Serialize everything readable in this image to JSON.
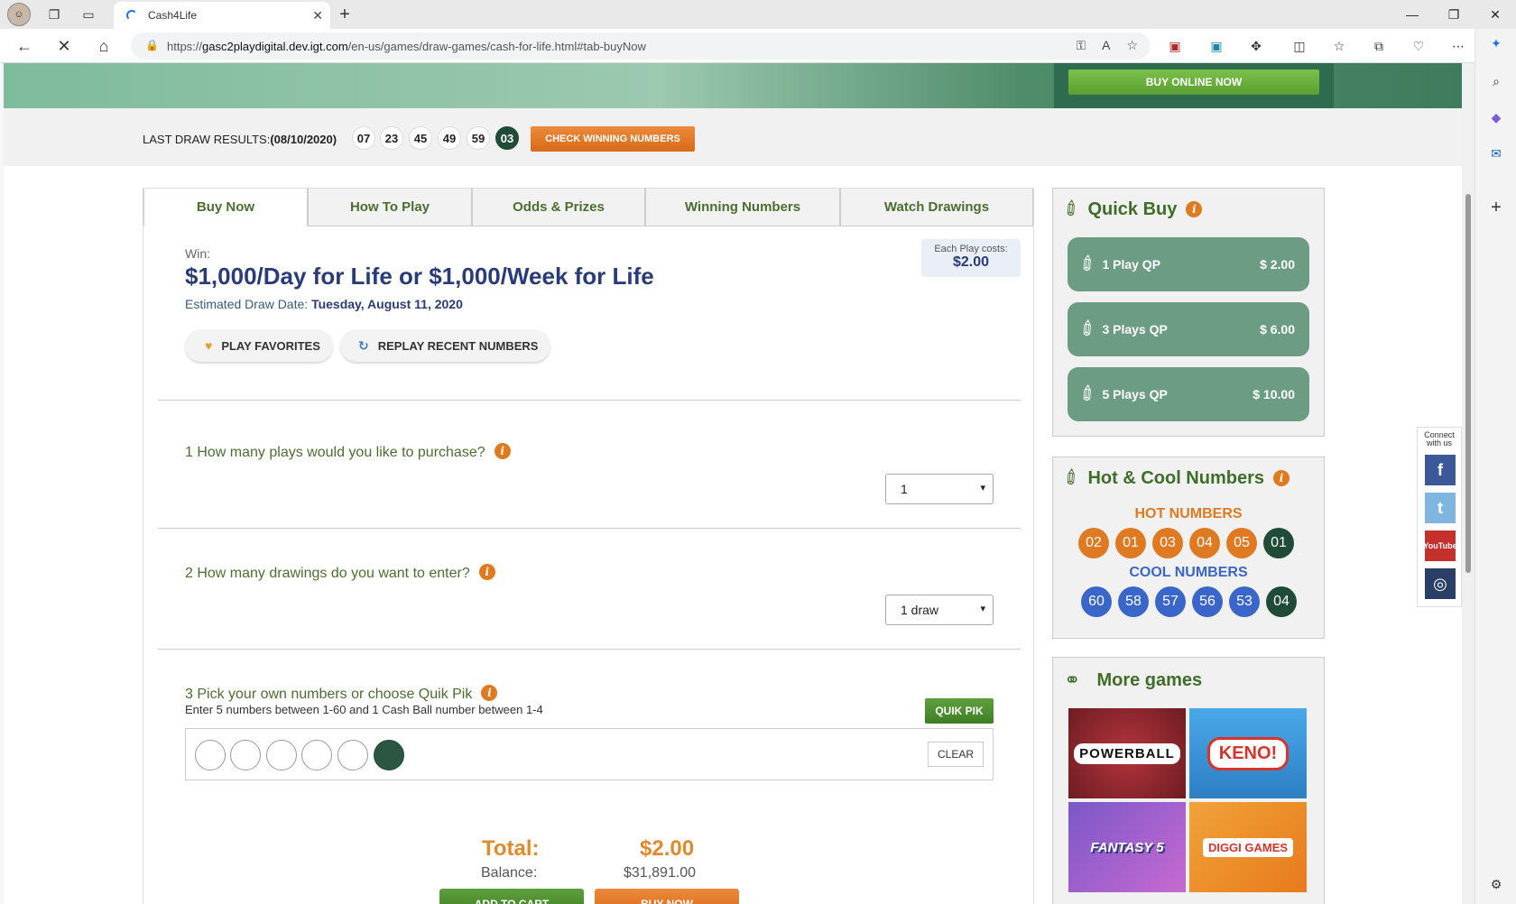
{
  "browser": {
    "tab_title": "Cash4Life",
    "url_prefix": "https://",
    "url_host": "gasc2playdigital.dev.igt.com",
    "url_path": "/en-us/games/draw-games/cash-for-life.html#tab-buyNow"
  },
  "hero": {
    "buy_online": "BUY ONLINE NOW"
  },
  "last_draw": {
    "label": "LAST DRAW RESULTS:",
    "date": "(08/10/2020)",
    "numbers": [
      "07",
      "23",
      "45",
      "49",
      "59"
    ],
    "cash_ball": "03",
    "check_button": "CHECK WINNING NUMBERS"
  },
  "tabs": [
    "Buy Now",
    "How To Play",
    "Odds & Prizes",
    "Winning Numbers",
    "Watch Drawings"
  ],
  "buy": {
    "win_label": "Win:",
    "jackpot": "$1,000/Day for Life or $1,000/Week for Life",
    "draw_date_label": "Estimated Draw Date:",
    "draw_date": "Tuesday, August 11, 2020",
    "cost_label": "Each Play costs:",
    "cost_value": "$2.00",
    "play_favorites": "PLAY FAVORITES",
    "replay_recent": "REPLAY RECENT NUMBERS",
    "q1": "1 How many plays would you like to purchase?",
    "q1_value": "1",
    "q2": "2 How many drawings do you want to enter?",
    "q2_value": "1 draw",
    "q3": "3 Pick your own numbers or choose Quik Pik",
    "enter_text": "Enter 5 numbers between 1-60 and 1 Cash Ball number between 1-4",
    "quik_pik": "QUIK PIK",
    "clear": "CLEAR",
    "total_label": "Total:",
    "total_value": "$2.00",
    "balance_label": "Balance:",
    "balance_value": "$31,891.00",
    "add_to_cart": "ADD TO CART",
    "buy_now": "BUY NOW"
  },
  "quick_buy": {
    "title": "Quick Buy",
    "options": [
      {
        "label": "1 Play QP",
        "price": "$ 2.00"
      },
      {
        "label": "3 Plays QP",
        "price": "$ 6.00"
      },
      {
        "label": "5 Plays QP",
        "price": "$ 10.00"
      }
    ]
  },
  "hot_cool": {
    "title": "Hot & Cool Numbers",
    "hot_label": "HOT NUMBERS",
    "hot": [
      "02",
      "01",
      "03",
      "04",
      "05"
    ],
    "hot_cash": "01",
    "cool_label": "COOL NUMBERS",
    "cool": [
      "60",
      "58",
      "57",
      "56",
      "53"
    ],
    "cool_cash": "04"
  },
  "more_games": {
    "title": "More games",
    "tiles": [
      "POWERBALL",
      "KENO!",
      "FANTASY 5",
      "DIGGI GAMES"
    ]
  },
  "connect": {
    "label": "Connect with us",
    "networks": [
      "f",
      "t",
      "YouTube",
      "◎"
    ]
  },
  "colors": {
    "brand_green": "#4b6e2f",
    "jackpot_blue": "#2a3b7a",
    "accent_orange": "#e07a22",
    "cool_blue": "#3a66c9",
    "cash_ball": "#1f4b37"
  }
}
